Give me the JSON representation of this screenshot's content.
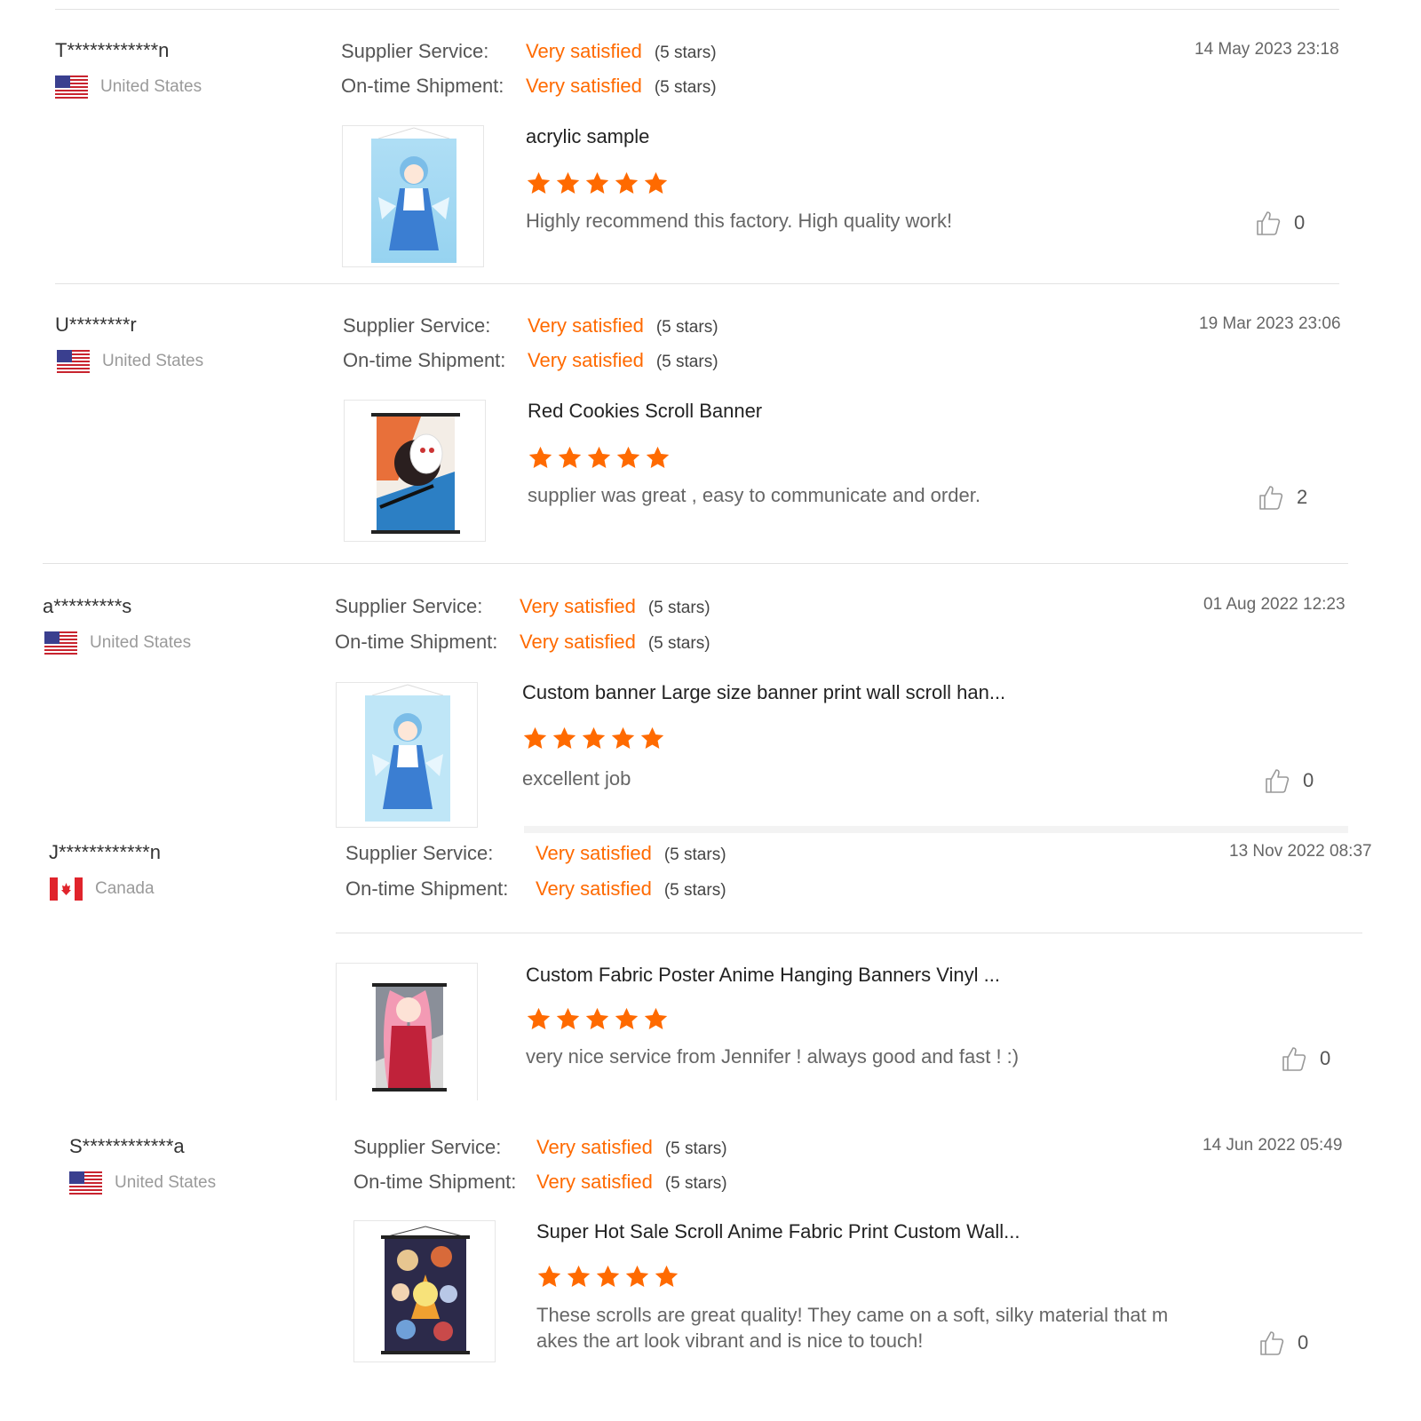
{
  "labels": {
    "supplier_service": "Supplier Service:",
    "ontime_shipment": "On-time Shipment:"
  },
  "colors": {
    "accent": "#ff6a00",
    "divider": "#e2e2e2"
  },
  "reviews": [
    {
      "user": "T************n",
      "country": "United States",
      "flag": "us-flag-icon",
      "supplier_value": "Very satisfied",
      "supplier_stars": "(5 stars)",
      "shipment_value": "Very satisfied",
      "shipment_stars": "(5 stars)",
      "date": "14 May 2023 23:18",
      "product": "acrylic sample",
      "thumbnail": "anime-scroll-blue-girl",
      "rating": 5,
      "comment": "Highly recommend this factory. High quality work!",
      "likes": "0"
    },
    {
      "user": "U********r",
      "country": "United States",
      "flag": "us-flag-icon",
      "supplier_value": "Very satisfied",
      "supplier_stars": "(5 stars)",
      "shipment_value": "Very satisfied",
      "shipment_stars": "(5 stars)",
      "date": "19 Mar 2023 23:06",
      "product": "Red Cookies Scroll Banner",
      "thumbnail": "anime-scroll-masked-swordsman",
      "rating": 5,
      "comment": "supplier was great , easy to communicate and order.",
      "likes": "2"
    },
    {
      "user": "a*********s",
      "country": "United States",
      "flag": "us-flag-icon",
      "supplier_value": "Very satisfied",
      "supplier_stars": "(5 stars)",
      "shipment_value": "Very satisfied",
      "shipment_stars": "(5 stars)",
      "date": "01 Aug 2022 12:23",
      "product": "Custom banner Large size banner print wall scroll han...",
      "thumbnail": "anime-scroll-blue-girl",
      "rating": 5,
      "comment": "excellent job",
      "likes": "0"
    },
    {
      "user": "J************n",
      "country": "Canada",
      "flag": "canada-flag-icon",
      "supplier_value": "Very satisfied",
      "supplier_stars": "(5 stars)",
      "shipment_value": "Very satisfied",
      "shipment_stars": "(5 stars)",
      "date": "13 Nov 2022 08:37",
      "product": "Custom Fabric Poster Anime Hanging Banners Vinyl ...",
      "thumbnail": "anime-scroll-pink-hair-girl",
      "rating": 5,
      "comment": "very nice service from Jennifer ! always good and fast ! :)",
      "likes": "0"
    },
    {
      "user": "S************a",
      "country": "United States",
      "flag": "us-flag-icon",
      "supplier_value": "Very satisfied",
      "supplier_stars": "(5 stars)",
      "shipment_value": "Very satisfied",
      "shipment_stars": "(5 stars)",
      "date": "14 Jun 2022 05:49",
      "product": "Super Hot Sale Scroll Anime Fabric Print Custom Wall...",
      "thumbnail": "anime-scroll-group-collage",
      "rating": 5,
      "comment": "These scrolls are great quality! They came on a soft, silky material that makes the art look vibrant and is nice to touch!",
      "likes": "0"
    }
  ]
}
